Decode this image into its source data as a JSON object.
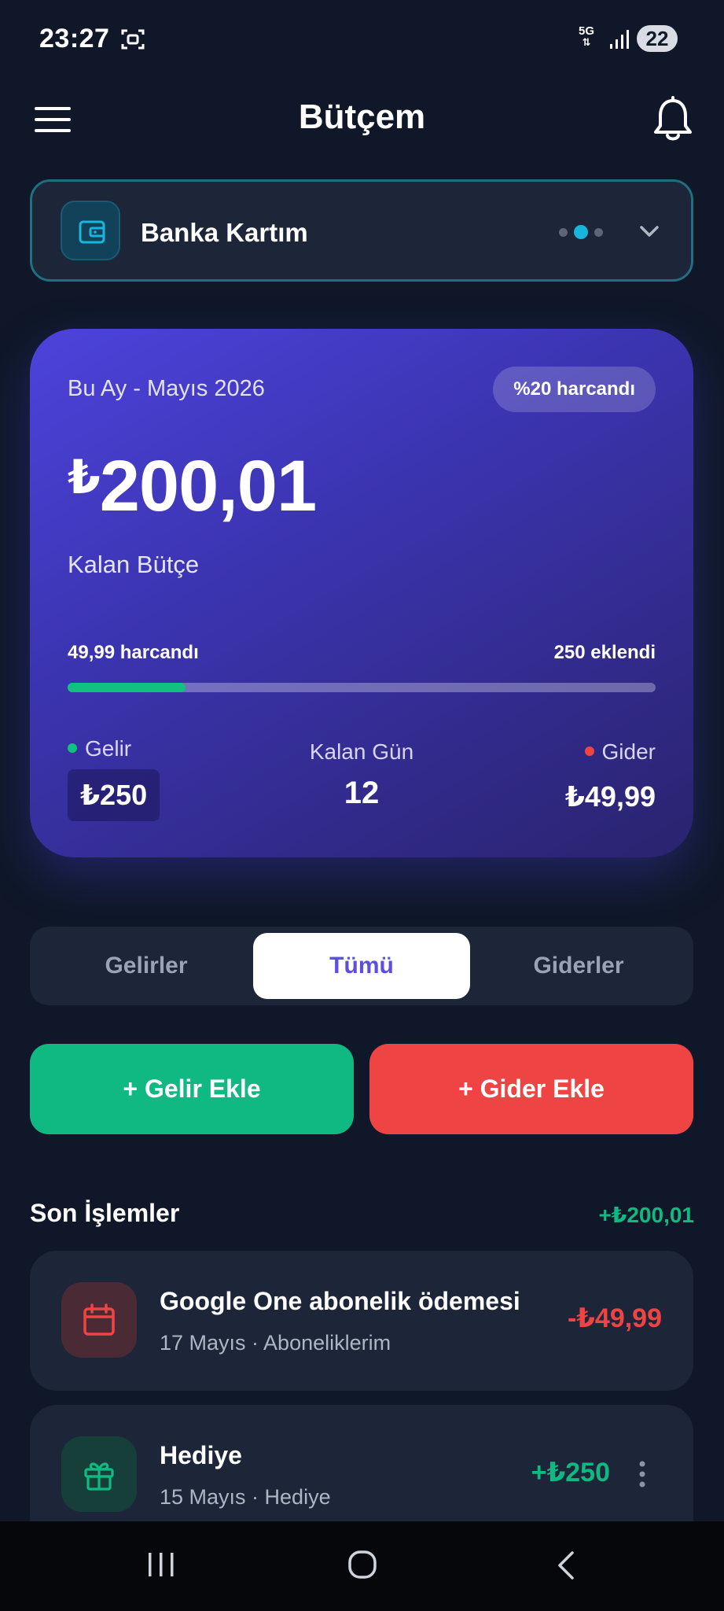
{
  "status_bar": {
    "time": "23:27",
    "network_label": "5G",
    "battery_level": "22"
  },
  "header": {
    "title": "Bütçem"
  },
  "account": {
    "name": "Banka Kartım",
    "dots_count": 3,
    "active_dot": 1
  },
  "budget_card": {
    "period": "Bu Ay - Mayıs 2026",
    "spent_percent_badge": "%20 harcandı",
    "currency_symbol": "₺",
    "balance": "200,01",
    "balance_label": "Kalan Bütçe",
    "spent_text": "49,99 harcandı",
    "added_text": "250 eklendi",
    "progress_fraction": 0.2,
    "income_label": "Gelir",
    "income_value": "₺250",
    "days_label": "Kalan Gün",
    "days_value": "12",
    "expense_label": "Gider",
    "expense_value": "₺49,99"
  },
  "tabs": [
    {
      "label": "Gelirler",
      "selected": false
    },
    {
      "label": "Tümü",
      "selected": true
    },
    {
      "label": "Giderler",
      "selected": false
    }
  ],
  "actions": {
    "add_income": "+ Gelir Ekle",
    "add_expense": "+ Gider Ekle"
  },
  "recent": {
    "title": "Son İşlemler",
    "total": "+₺200,01",
    "items": [
      {
        "title": "Google One abonelik ödemesi",
        "meta": "17 Mayıs · Aboneliklerim",
        "amount": "-₺49,99",
        "icon": "calendar-icon",
        "kind": "expense"
      },
      {
        "title": "Hediye",
        "meta": "15 Mayıs · Hediye",
        "amount": "+₺250",
        "icon": "gift-icon",
        "kind": "income"
      }
    ]
  },
  "colors": {
    "background": "#0f1728",
    "accent_income": "#10b981",
    "accent_expense": "#ef4444",
    "card_gradient_start": "#4d43dc",
    "card_gradient_end": "#2a236e",
    "active_tab_text": "#5b4fdc"
  }
}
